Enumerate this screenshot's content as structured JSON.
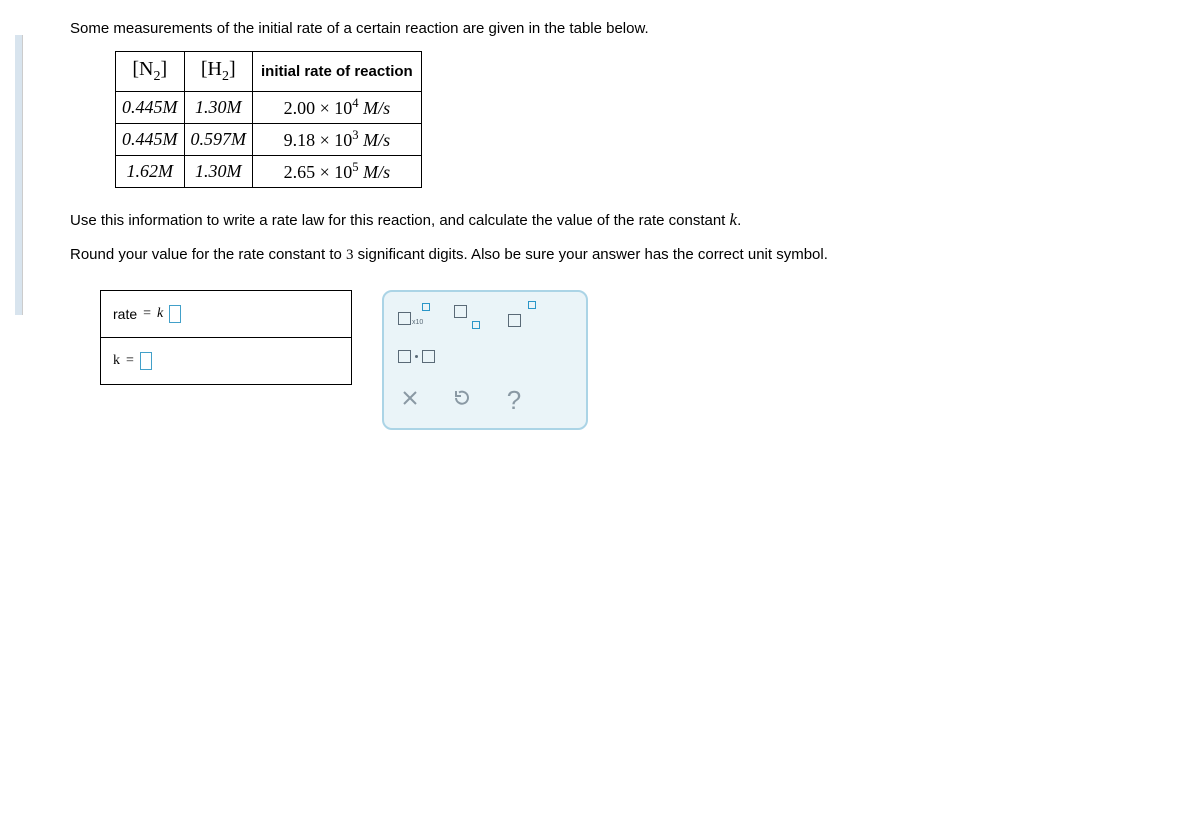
{
  "intro": "Some measurements of the initial rate of a certain reaction are given in the table below.",
  "table": {
    "headers": {
      "n2_pre": "[N",
      "n2_sub": "2",
      "n2_post": "]",
      "h2_pre": "[H",
      "h2_sub": "2",
      "h2_post": "]",
      "rate": "initial rate of reaction"
    },
    "rows": [
      {
        "n2_val": "0.445",
        "n2_unit": "M",
        "h2_val": "1.30",
        "h2_unit": "M",
        "rate_coef": "2.00",
        "rate_times": " × 10",
        "rate_exp": "4",
        "rate_unit": " M/s"
      },
      {
        "n2_val": "0.445",
        "n2_unit": "M",
        "h2_val": "0.597",
        "h2_unit": "M",
        "rate_coef": "9.18",
        "rate_times": " × 10",
        "rate_exp": "3",
        "rate_unit": " M/s"
      },
      {
        "n2_val": "1.62",
        "n2_unit": "M",
        "h2_val": "1.30",
        "h2_unit": "M",
        "rate_coef": "2.65",
        "rate_times": " × 10",
        "rate_exp": "5",
        "rate_unit": " M/s"
      }
    ]
  },
  "instruction1_pre": "Use this information to write a rate law for this reaction, and calculate the value of the rate constant ",
  "instruction1_k": "k",
  "instruction1_post": ".",
  "instruction2_pre": "Round your value for the rate constant to ",
  "instruction2_num": "3",
  "instruction2_post": " significant digits. Also be sure your answer has the correct unit symbol.",
  "answers": {
    "rate_label_pre": "rate ",
    "rate_label_eq": "= ",
    "rate_label_k": "k",
    "k_label": "k ",
    "k_eq": "= "
  },
  "toolbox": {
    "x10": "x10"
  },
  "chart_data": {
    "type": "table",
    "columns": [
      "[N2]",
      "[H2]",
      "initial rate of reaction"
    ],
    "rows": [
      [
        "0.445 M",
        "1.30 M",
        "2.00 × 10^4 M/s"
      ],
      [
        "0.445 M",
        "0.597 M",
        "9.18 × 10^3 M/s"
      ],
      [
        "1.62 M",
        "1.30 M",
        "2.65 × 10^5 M/s"
      ]
    ]
  }
}
